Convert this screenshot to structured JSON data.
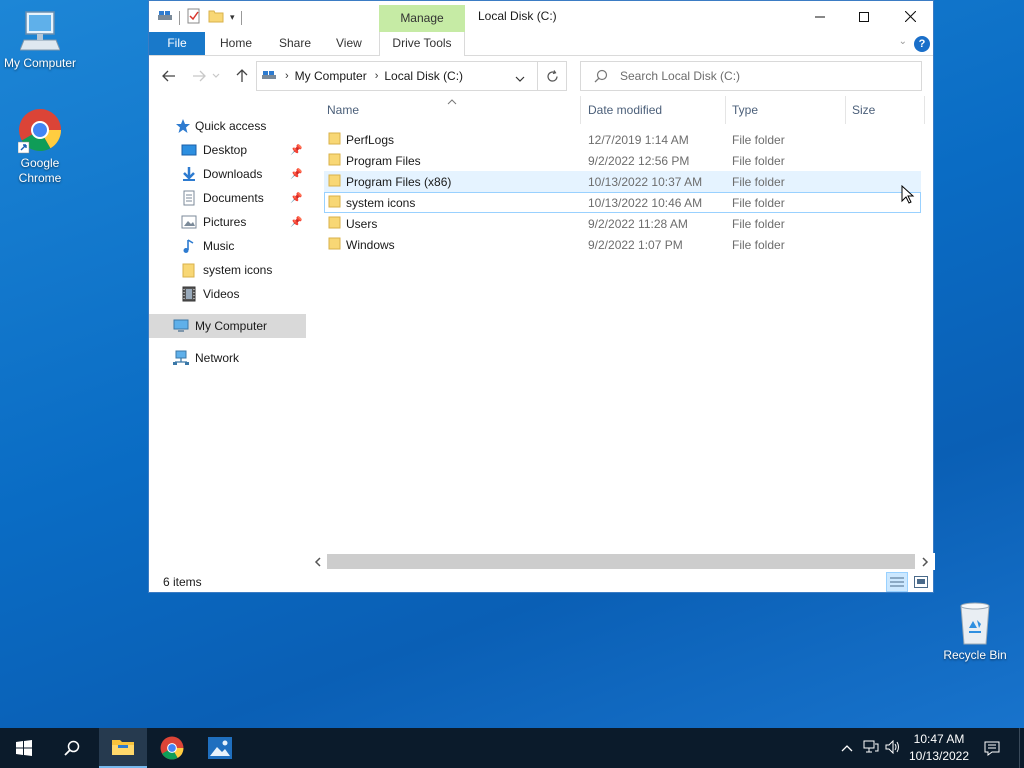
{
  "desktop": {
    "icons": [
      {
        "label": "My Computer",
        "icon": "computer-icon"
      },
      {
        "label": "Google Chrome",
        "icon": "chrome-icon"
      },
      {
        "label": "Recycle Bin",
        "icon": "recycle-bin-icon"
      }
    ]
  },
  "window": {
    "title": "Local Disk (C:)",
    "manage_tab": "Manage",
    "drive_tools_tab": "Drive Tools",
    "ribbon_tabs": [
      "File",
      "Home",
      "Share",
      "View"
    ],
    "help": "?"
  },
  "address": {
    "crumbs": [
      "My Computer",
      "Local Disk (C:)"
    ],
    "search_placeholder": "Search Local Disk (C:)"
  },
  "nav": {
    "quick_access": "Quick access",
    "items": [
      {
        "label": "Desktop",
        "icon": "desktop-icon",
        "pinned": true
      },
      {
        "label": "Downloads",
        "icon": "downloads-icon",
        "pinned": true
      },
      {
        "label": "Documents",
        "icon": "documents-icon",
        "pinned": true
      },
      {
        "label": "Pictures",
        "icon": "pictures-icon",
        "pinned": true
      },
      {
        "label": "Music",
        "icon": "music-icon",
        "pinned": false
      },
      {
        "label": "system icons",
        "icon": "folder-icon",
        "pinned": false
      },
      {
        "label": "Videos",
        "icon": "videos-icon",
        "pinned": false
      }
    ],
    "my_computer": "My Computer",
    "network": "Network"
  },
  "columns": [
    "Name",
    "Date modified",
    "Type",
    "Size"
  ],
  "files": [
    {
      "name": "PerfLogs",
      "date": "12/7/2019 1:14 AM",
      "type": "File folder"
    },
    {
      "name": "Program Files",
      "date": "9/2/2022 12:56 PM",
      "type": "File folder"
    },
    {
      "name": "Program Files (x86)",
      "date": "10/13/2022 10:37 AM",
      "type": "File folder"
    },
    {
      "name": "system icons",
      "date": "10/13/2022 10:46 AM",
      "type": "File folder"
    },
    {
      "name": "Users",
      "date": "9/2/2022 11:28 AM",
      "type": "File folder"
    },
    {
      "name": "Windows",
      "date": "9/2/2022 1:07 PM",
      "type": "File folder"
    }
  ],
  "status": {
    "item_count": "6 items"
  },
  "taskbar": {
    "time": "10:47 AM",
    "date": "10/13/2022"
  },
  "colors": {
    "accent": "#1979ca",
    "manage": "#c6eba5",
    "folder": "#f8d775",
    "desktop": "#0a6cc4"
  }
}
